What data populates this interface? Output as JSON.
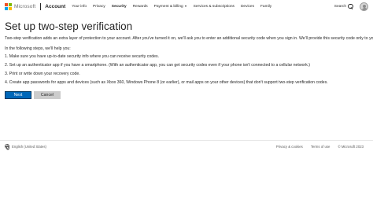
{
  "colors": {
    "ms_logo": [
      "#f25022",
      "#7fba00",
      "#00a4ef",
      "#ffb900"
    ],
    "primary_button": "#0067b8",
    "secondary_button": "#cccccc"
  },
  "header": {
    "brand": "Microsoft",
    "product": "Account",
    "nav": [
      {
        "label": "Your info",
        "dropdown": false
      },
      {
        "label": "Privacy",
        "dropdown": false
      },
      {
        "label": "Security",
        "dropdown": false,
        "active": true
      },
      {
        "label": "Rewards",
        "dropdown": false
      },
      {
        "label": "Payment & billing",
        "dropdown": true
      },
      {
        "label": "Services & subscriptions",
        "dropdown": false
      },
      {
        "label": "Devices",
        "dropdown": false
      },
      {
        "label": "Family",
        "dropdown": false
      }
    ],
    "search_label": "Search"
  },
  "main": {
    "title": "Set up two-step verification",
    "intro": "Two-step verification adds an extra layer of protection to your account. After you've turned it on, we'll ask you to enter an additional security code when you sign in. We'll provide this security code only to you.",
    "steps_heading": "In the following steps, we'll help you:",
    "steps": [
      "1. Make sure you have up-to-date security info where you can receive security codes.",
      "2. Set up an authenticator app if you have a smartphone. (With an authenticator app, you can get security codes even if your phone isn't connected to a cellular network.)",
      "3. Print or write down your recovery code.",
      "4. Create app passwords for apps and devices (such as Xbox 360, Windows Phone 8 (or earlier), or mail apps on your other devices) that don't support two-step verification codes."
    ],
    "next_label": "Next",
    "cancel_label": "Cancel"
  },
  "footer": {
    "locale": "English (United States)",
    "links": [
      "Privacy & cookies",
      "Terms of use",
      "© Microsoft 2023"
    ]
  }
}
